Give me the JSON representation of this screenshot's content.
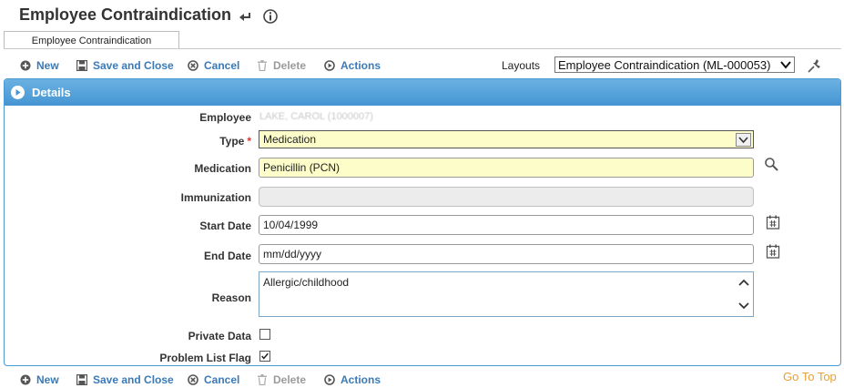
{
  "page": {
    "title": "Employee Contraindication"
  },
  "tabs": [
    {
      "label": "Employee Contraindication"
    }
  ],
  "toolbar": {
    "new_label": "New",
    "save_close_label": "Save and Close",
    "cancel_label": "Cancel",
    "delete_label": "Delete",
    "actions_label": "Actions"
  },
  "layouts": {
    "label": "Layouts",
    "selected": "Employee Contraindication (ML-000053)"
  },
  "details": {
    "header": "Details"
  },
  "form": {
    "employee": {
      "label": "Employee",
      "value": "LAKE, CAROL (1000007)"
    },
    "type": {
      "label": "Type",
      "required_mark": "*",
      "value": "Medication"
    },
    "medication": {
      "label": "Medication",
      "value": "Penicillin (PCN)"
    },
    "immunization": {
      "label": "Immunization",
      "value": ""
    },
    "start_date": {
      "label": "Start Date",
      "value": "10/04/1999"
    },
    "end_date": {
      "label": "End Date",
      "placeholder": "mm/dd/yyyy"
    },
    "reason": {
      "label": "Reason",
      "value": "Allergic/childhood"
    },
    "private_data": {
      "label": "Private Data",
      "checked": false
    },
    "problem_list_flag": {
      "label": "Problem List Flag",
      "checked": true
    }
  },
  "footer": {
    "go_to_top": "Go To Top"
  },
  "colors": {
    "accent": "#3a7ab8",
    "header_blue": "#4595d3",
    "required_field": "#fdfdca",
    "go_to_top": "#e8a036"
  }
}
